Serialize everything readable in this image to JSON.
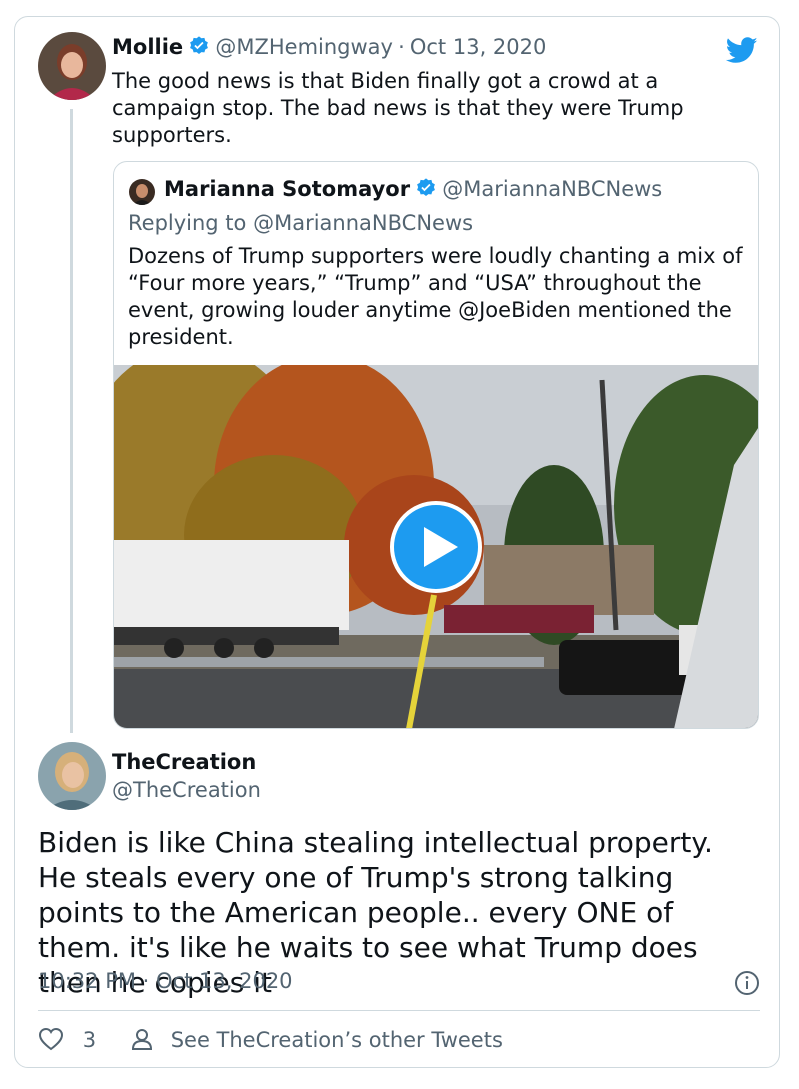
{
  "main_tweet": {
    "author_name": "Mollie",
    "author_handle": "@MZHemingway",
    "separator": "·",
    "date": "Oct 13, 2020",
    "text": "The good news is that Biden finally got a crowd at a campaign stop. The bad news is that they were Trump supporters."
  },
  "quoted_tweet": {
    "author_name": "Marianna Sotomayor",
    "author_handle": "@MariannaNBCNews",
    "replying_to_label": "Replying to",
    "replying_to_handle": "@MariannaNBCNews",
    "text": "Dozens of Trump supporters were loudly chanting a mix of “Four more years,” “Trump” and “USA” throughout the event, growing louder anytime @JoeBiden mentioned the president.",
    "media_icon": "play-icon"
  },
  "reply_tweet": {
    "author_name": "TheCreation",
    "author_handle": "@TheCreation",
    "text": "Biden is like China stealing intellectual property. He steals every one of Trump's strong talking points to the American people.. every ONE of them. it's like he waits to see what Trump does then he copies it",
    "time": "10:32 PM",
    "separator": "·",
    "date": "Oct 13, 2020"
  },
  "footer": {
    "like_count": "3",
    "other_tweets_label": "See TheCreation’s other Tweets"
  },
  "colors": {
    "brand_blue": "#1d9bf0",
    "muted_text": "#536471",
    "border": "#cfd9de"
  },
  "icons": [
    "twitter-bird-icon",
    "verified-badge-icon",
    "play-icon",
    "info-icon",
    "heart-icon",
    "person-icon"
  ]
}
